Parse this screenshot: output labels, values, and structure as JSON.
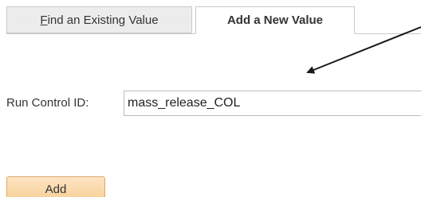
{
  "tabs": {
    "find": {
      "label_first": "F",
      "label_rest": "ind an Existing Value"
    },
    "add": {
      "label": "Add a New Value"
    }
  },
  "form": {
    "run_control_label": "Run Control ID:",
    "run_control_value": "mass_release_COL"
  },
  "actions": {
    "add_label": "Add"
  },
  "annotation": {
    "arrow_color": "#1a1a1a"
  }
}
